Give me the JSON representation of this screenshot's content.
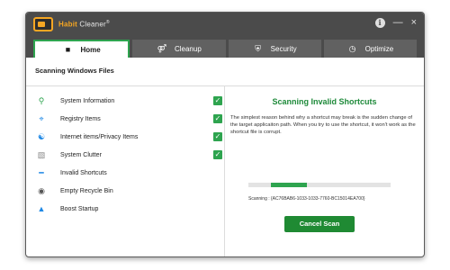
{
  "app": {
    "logo_accent": "Habit",
    "logo_rest": " Cleaner",
    "logo_reg": "®"
  },
  "window_controls": {
    "info": "i",
    "minimize": "—",
    "close": "×"
  },
  "tabs": [
    {
      "label": "Home",
      "icon": "home-icon",
      "active": true
    },
    {
      "label": "Cleanup",
      "icon": "broom-icon",
      "active": false
    },
    {
      "label": "Security",
      "icon": "shield-icon",
      "active": false
    },
    {
      "label": "Optimize",
      "icon": "speedometer-icon",
      "active": false
    }
  ],
  "section_title": "Scanning Windows Files",
  "items": [
    {
      "label": "System Information",
      "icon": "magnifier-icon",
      "icon_color": "#2ea44f",
      "checked": true
    },
    {
      "label": "Registry Items",
      "icon": "crosshair-icon",
      "icon_color": "#1e88e5",
      "checked": true
    },
    {
      "label": "Internet items/Privacy Items",
      "icon": "globe-icon",
      "icon_color": "#1e88e5",
      "checked": true
    },
    {
      "label": "System Clutter",
      "icon": "trash-icon",
      "icon_color": "#888888",
      "checked": true
    },
    {
      "label": "Invalid Shortcuts",
      "icon": "shortcut-icon",
      "icon_color": "#1e88e5",
      "checked": false
    },
    {
      "label": "Empty Recycle Bin",
      "icon": "recycle-bin-icon",
      "icon_color": "#555555",
      "checked": false
    },
    {
      "label": "Boost Startup",
      "icon": "rocket-icon",
      "icon_color": "#1e88e5",
      "checked": false
    }
  ],
  "scan": {
    "title": "Scanning Invalid Shortcuts",
    "description": "The simplest reason behind why a shortcut may break is the sudden change of the target applicaiton path. When you try to use the shortcut, it won't work as the shortcut file is corrupt.",
    "progress_track_start": 0.16,
    "progress_fill": 0.25,
    "scanning_text": "Scanning : {AC76BAB6-1033-1033-7760-BC15014EA700}",
    "cancel_label": "Cancel Scan"
  },
  "colors": {
    "accent_green": "#2ea44f",
    "title_green": "#1e8a3a",
    "titlebar": "#4b4b4b",
    "logo_orange": "#f5a623"
  }
}
